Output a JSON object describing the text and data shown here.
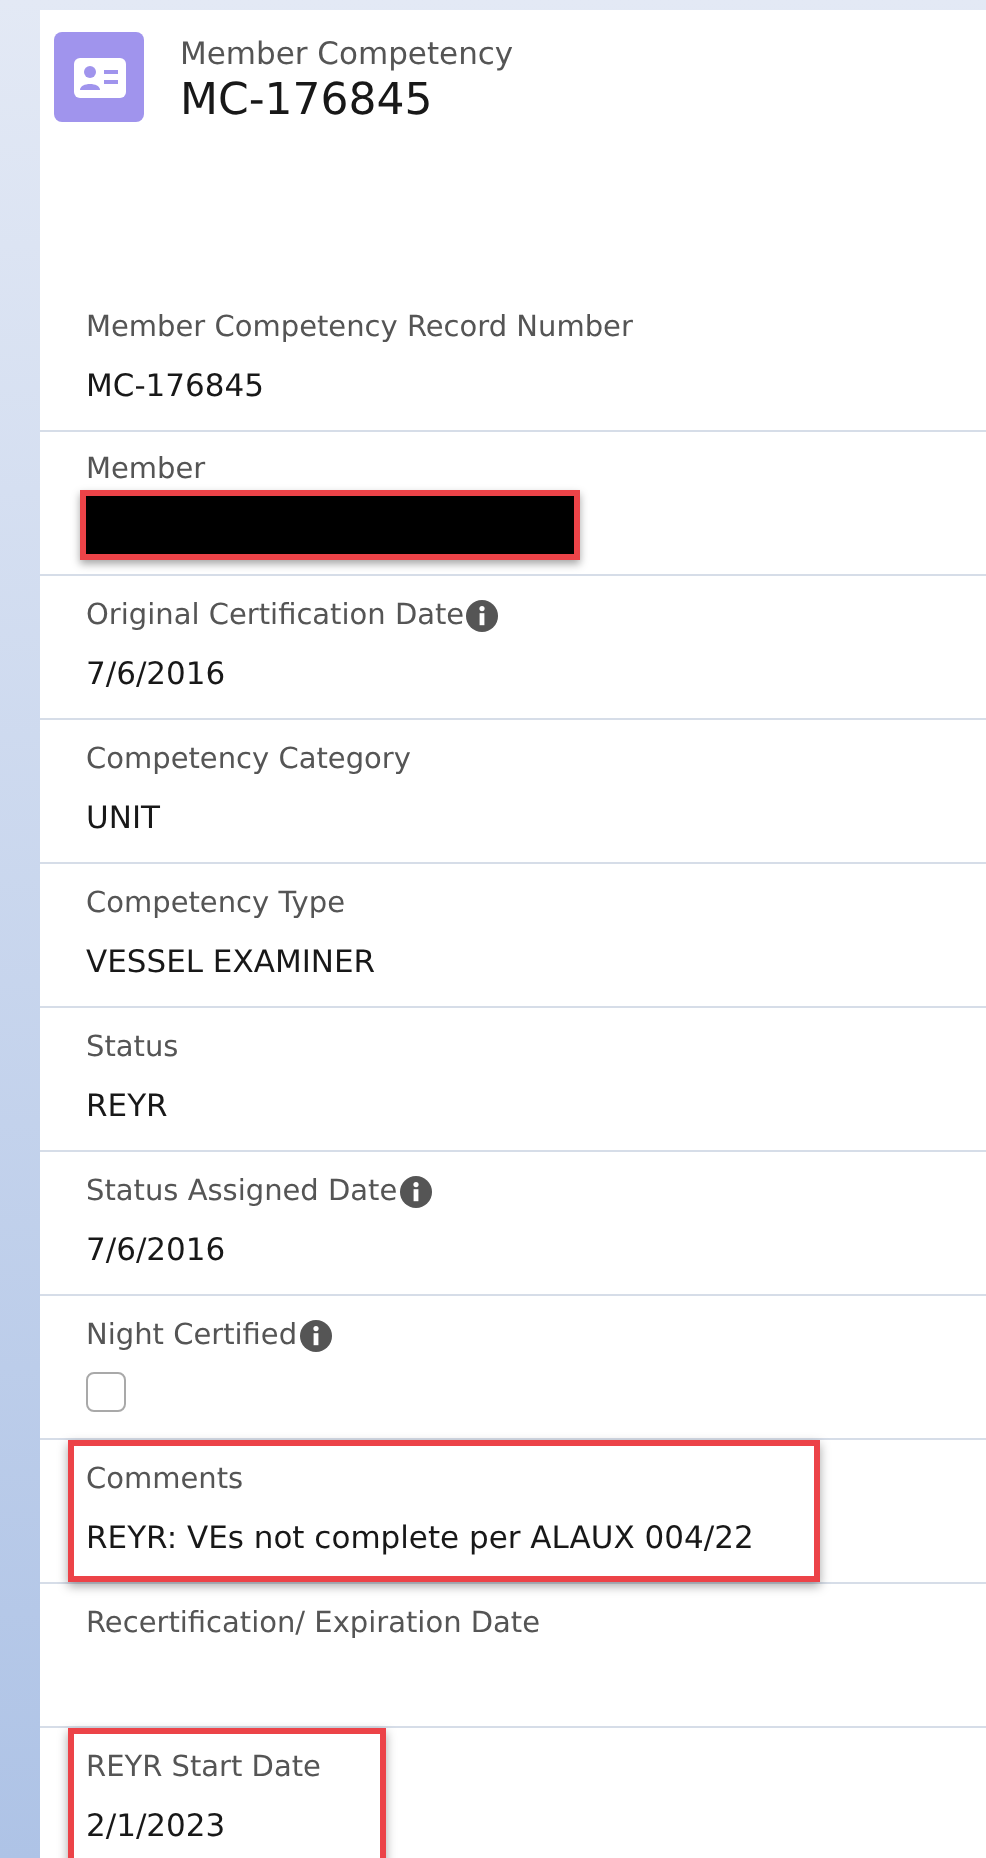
{
  "header": {
    "object_type": "Member Competency",
    "record_name": "MC-176845"
  },
  "fields": [
    {
      "kind": "text",
      "label": "Member Competency Record Number",
      "value": "MC-176845",
      "info": false,
      "highlighted": false
    },
    {
      "kind": "redacted",
      "label": "Member",
      "info": false,
      "highlighted": true
    },
    {
      "kind": "text",
      "label": "Original Certification Date",
      "value": "7/6/2016",
      "info": true,
      "highlighted": false
    },
    {
      "kind": "text",
      "label": "Competency Category",
      "value": "UNIT",
      "info": false,
      "highlighted": false
    },
    {
      "kind": "text",
      "label": "Competency Type",
      "value": "VESSEL EXAMINER",
      "info": false,
      "highlighted": false
    },
    {
      "kind": "text",
      "label": "Status",
      "value": "REYR",
      "info": false,
      "highlighted": false
    },
    {
      "kind": "text",
      "label": "Status Assigned Date",
      "value": "7/6/2016",
      "info": true,
      "highlighted": false
    },
    {
      "kind": "checkbox",
      "label": "Night Certified",
      "checked": false,
      "info": true,
      "highlighted": false
    },
    {
      "kind": "text",
      "label": "Comments",
      "value": "REYR: VEs not complete per ALAUX 004/22",
      "info": false,
      "highlighted": true
    },
    {
      "kind": "text",
      "label": "Recertification/ Expiration Date",
      "info": false,
      "highlighted": false
    },
    {
      "kind": "text",
      "label": "REYR Start Date",
      "value": "2/1/2023",
      "info": false,
      "highlighted": true
    }
  ]
}
